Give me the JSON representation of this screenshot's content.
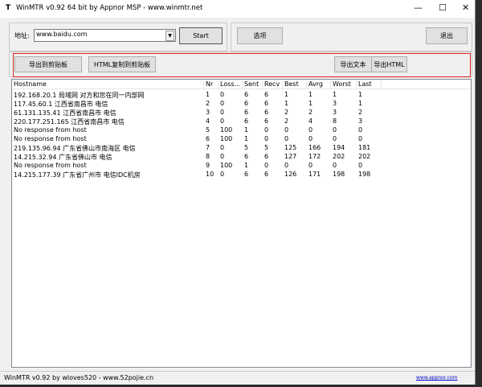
{
  "window": {
    "title": "WinMTR v0.92 64 bit by Appnor MSP - www.winmtr.net",
    "minimize": "—",
    "maximize": "☐",
    "close": "✕"
  },
  "toolbar": {
    "address_label": "地址:",
    "address_value": "www.baidu.com",
    "start": "Start",
    "options": "选项",
    "exit": "退出"
  },
  "export": {
    "copy_text": "导出到剪贴板",
    "copy_html": "HTML复制到剪贴板",
    "export_text": "导出文本",
    "export_html": "导出HTML"
  },
  "table": {
    "columns": [
      "Hostname",
      "Nr",
      "Loss...",
      "Sent",
      "Recv",
      "Best",
      "Avrg",
      "Worst",
      "Last"
    ],
    "rows": [
      [
        "192.168.20.1 局域网 对方和您在同一内部网",
        "1",
        "0",
        "6",
        "6",
        "1",
        "1",
        "1",
        "1"
      ],
      [
        "117.45.60.1 江西省南昌市 电信",
        "2",
        "0",
        "6",
        "6",
        "1",
        "1",
        "3",
        "1"
      ],
      [
        "61.131.135.41 江西省南昌市 电信",
        "3",
        "0",
        "6",
        "6",
        "2",
        "2",
        "3",
        "2"
      ],
      [
        "220.177.251.165 江西省南昌市 电信",
        "4",
        "0",
        "6",
        "6",
        "2",
        "4",
        "8",
        "3"
      ],
      [
        "No response from host",
        "5",
        "100",
        "1",
        "0",
        "0",
        "0",
        "0",
        "0"
      ],
      [
        "No response from host",
        "6",
        "100",
        "1",
        "0",
        "0",
        "0",
        "0",
        "0"
      ],
      [
        "219.135.96.94 广东省佛山市南海区 电信",
        "7",
        "0",
        "5",
        "5",
        "125",
        "166",
        "194",
        "181"
      ],
      [
        "14.215.32.94 广东省佛山市 电信",
        "8",
        "0",
        "6",
        "6",
        "127",
        "172",
        "202",
        "202"
      ],
      [
        "No response from host",
        "9",
        "100",
        "1",
        "0",
        "0",
        "0",
        "0",
        "0"
      ],
      [
        "14.215.177.39 广东省广州市 电信IDC机房",
        "10",
        "0",
        "6",
        "6",
        "126",
        "171",
        "198",
        "198"
      ]
    ]
  },
  "status": {
    "left": "WinMTR v0.92 by wloves520 - www.52pojie.cn",
    "link": "www.appnor.com"
  },
  "colors": {
    "highlight_border": "#e02020"
  }
}
